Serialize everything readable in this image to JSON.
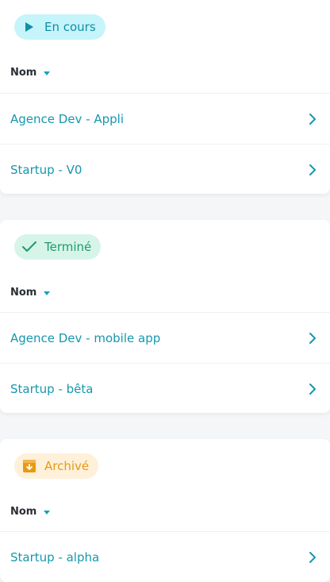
{
  "sections": [
    {
      "status_label": "En cours",
      "status_icon": "play-icon",
      "sort_label": "Nom",
      "projects": [
        "Agence Dev - Appli",
        "Startup - V0"
      ]
    },
    {
      "status_label": "Terminé",
      "status_icon": "check-icon",
      "sort_label": "Nom",
      "projects": [
        "Agence Dev - mobile app",
        "Startup - bêta"
      ]
    },
    {
      "status_label": "Archivé",
      "status_icon": "archive-icon",
      "sort_label": "Nom",
      "projects": [
        "Startup - alpha"
      ]
    }
  ],
  "colors": {
    "accent": "#1797ad",
    "in_progress_bg": "#c6f4fb",
    "done_bg": "#d6f5e8",
    "archived_bg": "#fff0d9",
    "archived_fg": "#e79a12"
  }
}
